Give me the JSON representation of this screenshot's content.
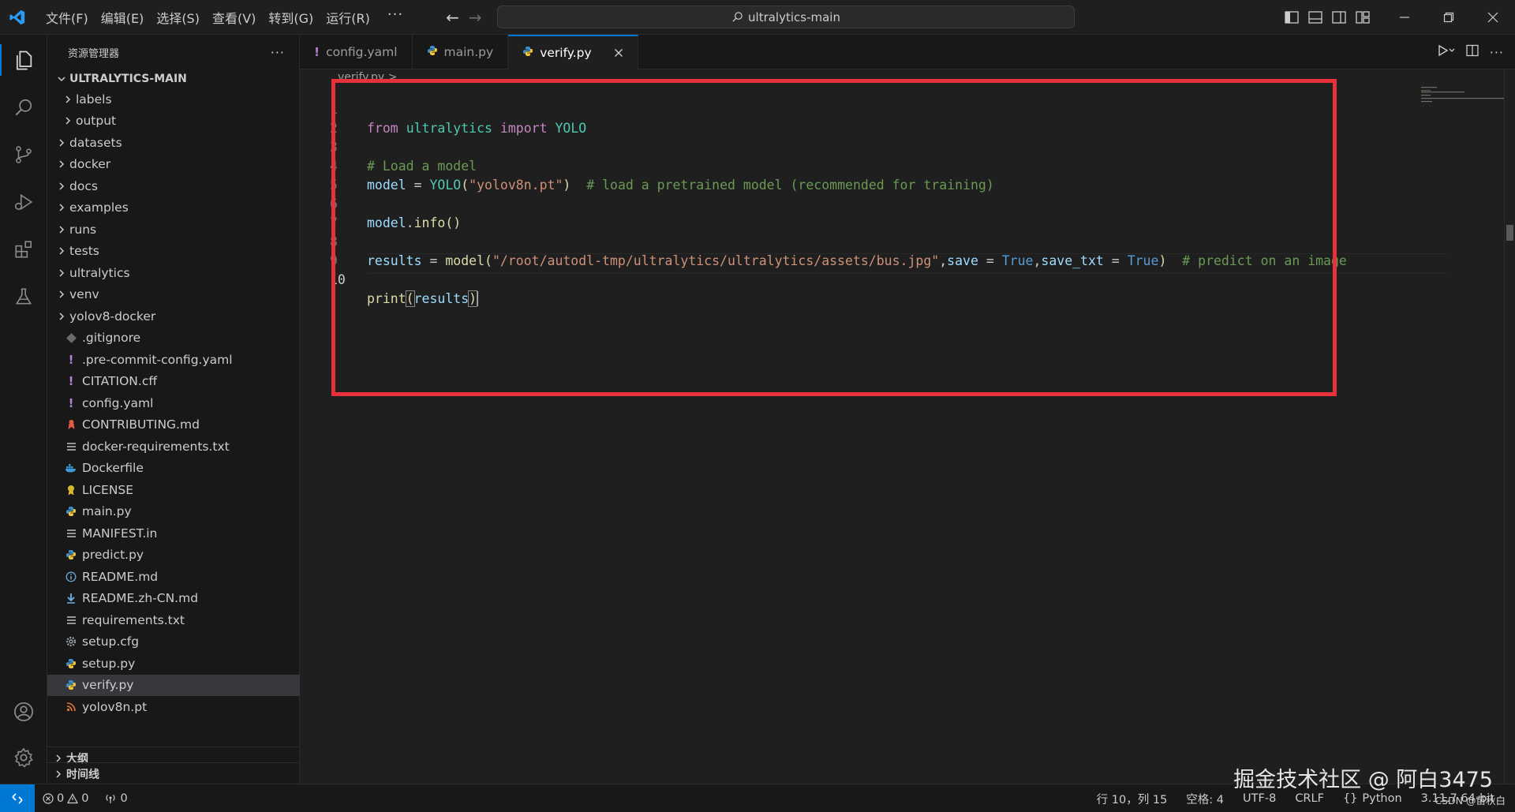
{
  "menu": [
    "文件(F)",
    "编辑(E)",
    "选择(S)",
    "查看(V)",
    "转到(G)",
    "运行(R)"
  ],
  "menu_more": "···",
  "search": {
    "text": "ultralytics-main"
  },
  "sidebar": {
    "header": "资源管理器",
    "more": "···",
    "root": "ULTRALYTICS-MAIN",
    "items": [
      {
        "label": "labels",
        "type": "folder",
        "indent": 1
      },
      {
        "label": "output",
        "type": "folder",
        "indent": 1
      },
      {
        "label": "datasets",
        "type": "folder",
        "indent": 0
      },
      {
        "label": "docker",
        "type": "folder",
        "indent": 0
      },
      {
        "label": "docs",
        "type": "folder",
        "indent": 0
      },
      {
        "label": "examples",
        "type": "folder",
        "indent": 0
      },
      {
        "label": "runs",
        "type": "folder",
        "indent": 0
      },
      {
        "label": "tests",
        "type": "folder",
        "indent": 0
      },
      {
        "label": "ultralytics",
        "type": "folder",
        "indent": 0
      },
      {
        "label": "venv",
        "type": "folder",
        "indent": 0
      },
      {
        "label": "yolov8-docker",
        "type": "folder",
        "indent": 0
      },
      {
        "label": ".gitignore",
        "type": "git",
        "indent": 0
      },
      {
        "label": ".pre-commit-config.yaml",
        "type": "yaml",
        "indent": 0
      },
      {
        "label": "CITATION.cff",
        "type": "yaml",
        "indent": 0
      },
      {
        "label": "config.yaml",
        "type": "yaml",
        "indent": 0
      },
      {
        "label": "CONTRIBUTING.md",
        "type": "contrib",
        "indent": 0
      },
      {
        "label": "docker-requirements.txt",
        "type": "text",
        "indent": 0
      },
      {
        "label": "Dockerfile",
        "type": "docker",
        "indent": 0
      },
      {
        "label": "LICENSE",
        "type": "license",
        "indent": 0
      },
      {
        "label": "main.py",
        "type": "python",
        "indent": 0
      },
      {
        "label": "MANIFEST.in",
        "type": "text",
        "indent": 0
      },
      {
        "label": "predict.py",
        "type": "python",
        "indent": 0
      },
      {
        "label": "README.md",
        "type": "info",
        "indent": 0
      },
      {
        "label": "README.zh-CN.md",
        "type": "download",
        "indent": 0
      },
      {
        "label": "requirements.txt",
        "type": "text",
        "indent": 0
      },
      {
        "label": "setup.cfg",
        "type": "gear",
        "indent": 0
      },
      {
        "label": "setup.py",
        "type": "python",
        "indent": 0
      },
      {
        "label": "verify.py",
        "type": "python",
        "indent": 0,
        "selected": true
      },
      {
        "label": "yolov8n.pt",
        "type": "rss",
        "indent": 0
      }
    ],
    "sections": [
      "大纲",
      "时间线"
    ]
  },
  "tabs": [
    {
      "label": "config.yaml",
      "type": "yaml"
    },
    {
      "label": "main.py",
      "type": "python"
    },
    {
      "label": "verify.py",
      "type": "python",
      "active": true
    }
  ],
  "breadcrumb": "verify.py > ...",
  "code": {
    "line_numbers": [
      "1",
      "2",
      "3",
      "4",
      "5",
      "6",
      "7",
      "8",
      "9",
      "10"
    ],
    "current_line": "10"
  },
  "status": {
    "errors": "0",
    "warnings": "0",
    "ports": "0",
    "cursor": "行 10，列 15",
    "indent": "空格: 4",
    "encoding": "UTF-8",
    "eol": "CRLF",
    "language": "Python",
    "interpreter": "3.11.7 64-bit"
  },
  "watermark": "掘金技术社区 @ 阿白3475",
  "csdn": "CSDN @苗秋白",
  "colors": {
    "accent": "#0078d4",
    "highlight": "#e8313a"
  }
}
